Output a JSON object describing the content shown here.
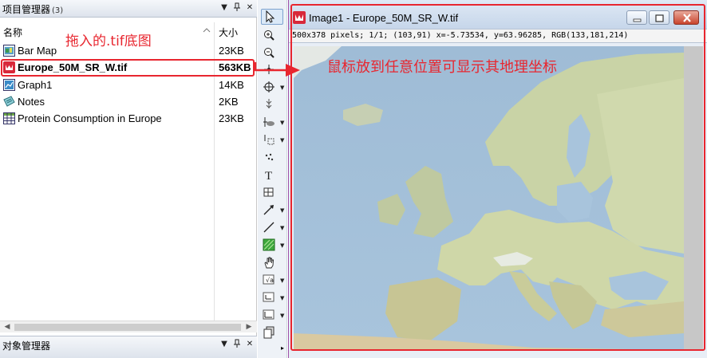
{
  "project_manager": {
    "title": "项目管理器",
    "count": "(3)",
    "col_name": "名称",
    "col_size": "大小",
    "items": [
      {
        "name": "Bar Map",
        "size": "23KB",
        "icon": "map-icon"
      },
      {
        "name": "Europe_50M_SR_W.tif",
        "size": "563KB",
        "icon": "image-icon",
        "selected": true
      },
      {
        "name": "Graph1",
        "size": "14KB",
        "icon": "graph-icon"
      },
      {
        "name": "Notes",
        "size": "2KB",
        "icon": "notes-icon"
      },
      {
        "name": "Protein Consumption in Europe",
        "size": "23KB",
        "icon": "table-icon"
      }
    ],
    "annotation": "拖入的.tif底图"
  },
  "object_manager": {
    "title": "对象管理器"
  },
  "toolbar": {
    "tools": [
      "pointer-icon",
      "zoom-in-icon",
      "zoom-out-icon",
      "pan-icon",
      "crosshair-icon",
      "screen-reader-icon",
      "data-reader-icon",
      "data-selector-icon",
      "mask-icon",
      "text-icon",
      "rectangle-icon",
      "arrow-icon",
      "line-icon",
      "region-icon",
      "hand-icon",
      "sigma-icon",
      "table-tool-icon",
      "graph-tool-icon",
      "layers-icon"
    ]
  },
  "image_window": {
    "title": "Image1 - Europe_50M_SR_W.tif",
    "info": "500x378 pixels; 1/1; (103,91) x=-5.73534, y=63.96285, RGB(133,181,214)",
    "annotation": "鼠标放到任意位置可显示其地理坐标"
  },
  "colors": {
    "annotation": "#e8262f",
    "land": "#cfd9a8",
    "sea": "#a9c3db"
  }
}
